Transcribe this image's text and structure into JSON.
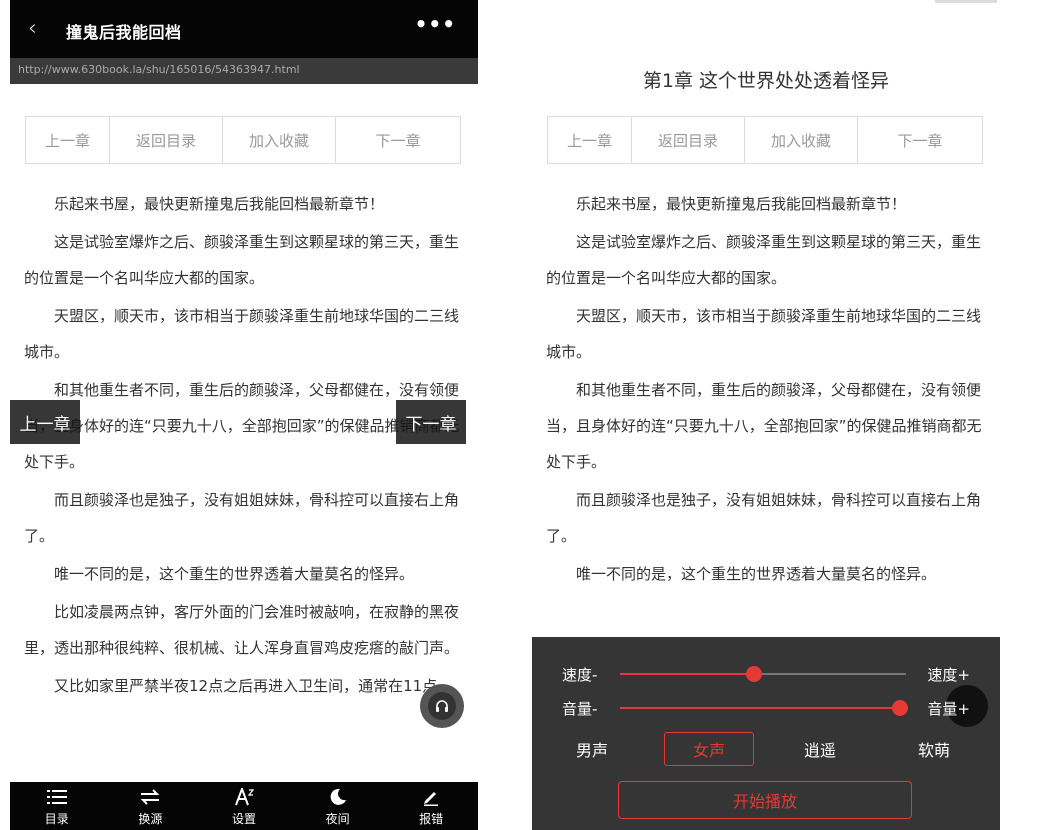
{
  "left": {
    "topbar": {
      "back_glyph": "‹",
      "title": "撞鬼后我能回档",
      "more_glyph": "•••"
    },
    "url": "http://www.630book.la/shu/165016/54363947.html",
    "nav": {
      "prev": "上一章",
      "toc": "返回目录",
      "bookmark": "加入收藏",
      "next": "下一章"
    },
    "paragraphs": [
      "乐起来书屋，最快更新撞鬼后我能回档最新章节！",
      "这是试验室爆炸之后、颜骏泽重生到这颗星球的第三天，重生的位置是一个名叫华应大都的国家。",
      "天盟区，顺天市，该市相当于颜骏泽重生前地球华国的二三线城市。",
      "和其他重生者不同，重生后的颜骏泽，父母都健在，没有领便当，且身体好的连“只要九十八，全部抱回家”的保健品推销商都无处下手。",
      "而且颜骏泽也是独子，没有姐姐妹妹，骨科控可以直接右上角了。",
      "唯一不同的是，这个重生的世界透着大量莫名的怪异。",
      "比如凌晨两点钟，客厅外面的门会准时被敲响，在寂静的黑夜里，透出那种很纯粹、很机械、让人浑身直冒鸡皮疙瘩的敲门声。",
      "又比如家里严禁半夜12点之后再进入卫生间，通常在11点"
    ],
    "side": {
      "prev": "上一章",
      "next": "下一章"
    },
    "bottom": [
      {
        "icon": "list-icon",
        "label": "目录"
      },
      {
        "icon": "swap-icon",
        "label": "换源"
      },
      {
        "icon": "font-size-icon",
        "label": "设置"
      },
      {
        "icon": "moon-icon",
        "label": "夜间"
      },
      {
        "icon": "pencil-icon",
        "label": "报错"
      }
    ]
  },
  "right": {
    "chapter_title": "第1章 这个世界处处透着怪异",
    "nav": {
      "prev": "上一章",
      "toc": "返回目录",
      "bookmark": "加入收藏",
      "next": "下一章"
    },
    "paragraphs": [
      "乐起来书屋，最快更新撞鬼后我能回档最新章节！",
      "这是试验室爆炸之后、颜骏泽重生到这颗星球的第三天，重生的位置是一个名叫华应大都的国家。",
      "天盟区，顺天市，该市相当于颜骏泽重生前地球华国的二三线城市。",
      "和其他重生者不同，重生后的颜骏泽，父母都健在，没有领便当，且身体好的连“只要九十八，全部抱回家”的保健品推销商都无处下手。",
      "而且颜骏泽也是独子，没有姐姐妹妹，骨科控可以直接右上角了。",
      "唯一不同的是，这个重生的世界透着大量莫名的怪异。"
    ],
    "tts": {
      "speed_minus": "速度-",
      "speed_plus": "速度+",
      "speed_level": 0.47,
      "volume_minus": "音量-",
      "volume_plus": "音量+",
      "volume_level": 0.98,
      "voices": [
        "男声",
        "女声",
        "逍遥",
        "软萌"
      ],
      "selected_voice": "女声",
      "start": "开始播放",
      "accent_color": "#e53935"
    }
  }
}
